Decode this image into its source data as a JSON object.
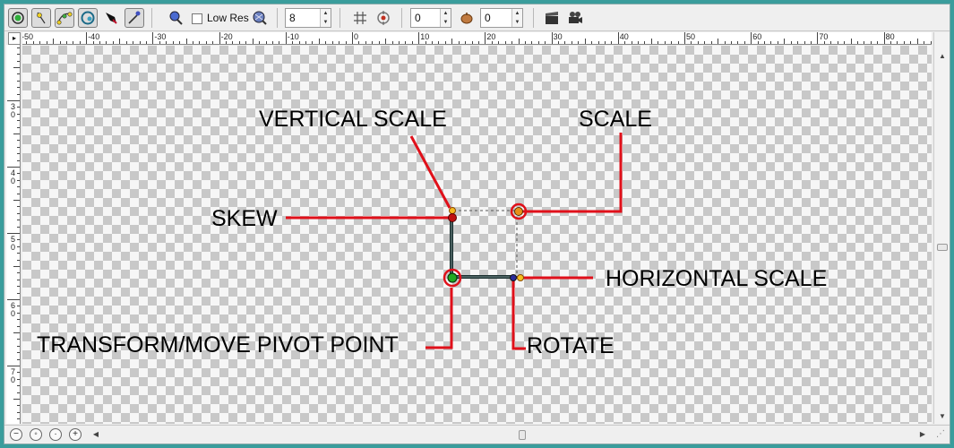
{
  "toolbar": {
    "low_res_label": "Low Res",
    "smoothness_value": "8",
    "value_a": "0",
    "value_b": "0",
    "tools": [
      "select-tool",
      "point-tool",
      "bezier-tool",
      "ellipse-tool",
      "pen-tool",
      "eyedropper-tool"
    ]
  },
  "ruler": {
    "h_labels": [
      "-50",
      "-40",
      "-30",
      "-20",
      "-10",
      "0",
      "10",
      "20",
      "30",
      "40",
      "50",
      "60",
      "70",
      "80"
    ],
    "v_labels": [
      "3 0",
      "4 0",
      "5 0",
      "6 0",
      "7 0"
    ],
    "corner": "▸"
  },
  "annotations": {
    "vertical_scale": "VERTICAL SCALE",
    "scale": "SCALE",
    "skew": "SKEW",
    "horizontal_scale": "HORIZONTAL SCALE",
    "transform_pivot": "TRANSFORM/MOVE PIVOT POINT",
    "rotate": "ROTATE"
  },
  "colors": {
    "frame": "#3a9d9c",
    "callout": "#e0101a",
    "handle_orange": "#e8901a",
    "pivot_green": "#22aa22",
    "bone": "#1b3030"
  }
}
